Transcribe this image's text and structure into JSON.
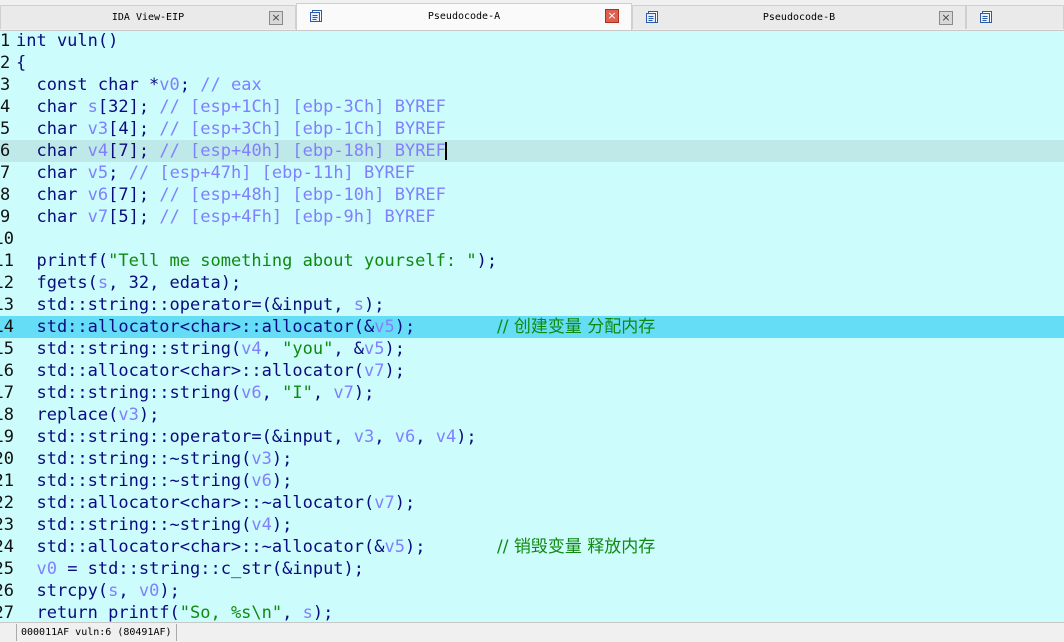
{
  "tabs": [
    {
      "title": "IDA View-EIP",
      "icon": "none",
      "close": "×",
      "active": false
    },
    {
      "title": "Pseudocode-A",
      "icon": "document-icon",
      "close": "×",
      "active": true
    },
    {
      "title": "Pseudocode-B",
      "icon": "document-icon",
      "close": "×",
      "active": false
    }
  ],
  "colors": {
    "code_background": "#ccfcfc",
    "current_line": "#bfe8e8",
    "selected_line": "#66ddf6",
    "code_text": "#0b0b80",
    "variable": "#8080ff",
    "string": "#0f8a0f",
    "comment": "#0f8a0f"
  },
  "code": {
    "line_numbers": [
      "1",
      "2",
      "3",
      "4",
      "5",
      "6",
      "7",
      "8",
      "9",
      "10",
      "11",
      "12",
      "13",
      "14",
      "15",
      "16",
      "17",
      "18",
      "19",
      "20",
      "21",
      "22",
      "23",
      "24",
      "25",
      "26",
      "27"
    ],
    "lines": [
      "int vuln()",
      "{",
      "  const char *v0; // eax",
      "  char s[32]; // [esp+1Ch] [ebp-3Ch] BYREF",
      "  char v3[4]; // [esp+3Ch] [ebp-1Ch] BYREF",
      "  char v4[7]; // [esp+40h] [ebp-18h] BYREF",
      "  char v5; // [esp+47h] [ebp-11h] BYREF",
      "  char v6[7]; // [esp+48h] [ebp-10h] BYREF",
      "  char v7[5]; // [esp+4Fh] [ebp-9h] BYREF",
      "",
      "  printf(\"Tell me something about yourself: \");",
      "  fgets(s, 32, edata);",
      "  std::string::operator=(&input, s);",
      "  std::allocator<char>::allocator(&v5);",
      "  std::string::string(v4, \"you\", &v5);",
      "  std::allocator<char>::allocator(v7);",
      "  std::string::string(v6, \"I\", v7);",
      "  replace(v3);",
      "  std::string::operator=(&input, v3, v6, v4);",
      "  std::string::~string(v3);",
      "  std::string::~string(v6);",
      "  std::allocator<char>::~allocator(v7);",
      "  std::string::~string(v4);",
      "  std::allocator<char>::~allocator(&v5);",
      "  v0 = std::string::c_str(&input);",
      "  strcpy(s, v0);",
      "  return printf(\"So, %s\\n\", s);"
    ],
    "annotations": {
      "14": "// 创建变量 分配内存",
      "24": "// 销毁变量 释放内存"
    },
    "current_line": 6,
    "selected_line": 14
  },
  "status_bar": {
    "text": "000011AF vuln:6 (80491AF)"
  }
}
